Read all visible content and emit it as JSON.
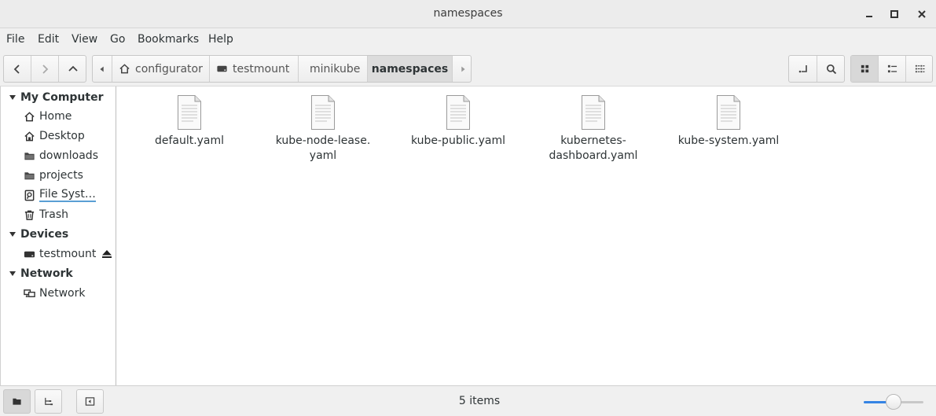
{
  "window": {
    "title": "namespaces"
  },
  "menu": [
    "File",
    "Edit",
    "View",
    "Go",
    "Bookmarks",
    "Help"
  ],
  "breadcrumbs": [
    {
      "label": "configurator",
      "icon": "home-icon"
    },
    {
      "label": "testmount",
      "icon": "drive-icon"
    },
    {
      "label": "minikube",
      "icon": ""
    },
    {
      "label": "namespaces",
      "icon": "",
      "active": true
    }
  ],
  "sidebar": {
    "sections": [
      {
        "title": "My Computer",
        "items": [
          {
            "label": "Home",
            "icon": "home-icon"
          },
          {
            "label": "Desktop",
            "icon": "desktop-icon"
          },
          {
            "label": "downloads",
            "icon": "folder-icon"
          },
          {
            "label": "projects",
            "icon": "folder-icon"
          },
          {
            "label": "File Syst…",
            "icon": "filesystem-icon"
          },
          {
            "label": "Trash",
            "icon": "trash-icon"
          }
        ]
      },
      {
        "title": "Devices",
        "items": [
          {
            "label": "testmount",
            "icon": "drive-icon",
            "eject": true
          }
        ]
      },
      {
        "title": "Network",
        "items": [
          {
            "label": "Network",
            "icon": "network-icon"
          }
        ]
      }
    ]
  },
  "files": [
    {
      "line1": "default.yaml",
      "line2": ""
    },
    {
      "line1": "kube-node-lease.",
      "line2": "yaml"
    },
    {
      "line1": "kube-public.yaml",
      "line2": ""
    },
    {
      "line1": "kubernetes-",
      "line2": "dashboard.yaml"
    },
    {
      "line1": "kube-system.yaml",
      "line2": ""
    }
  ],
  "status": {
    "items_text": "5 items",
    "zoom_level": 0.5
  },
  "colors": {
    "accent": "#3584e4",
    "underline": "#5a9fd4"
  }
}
